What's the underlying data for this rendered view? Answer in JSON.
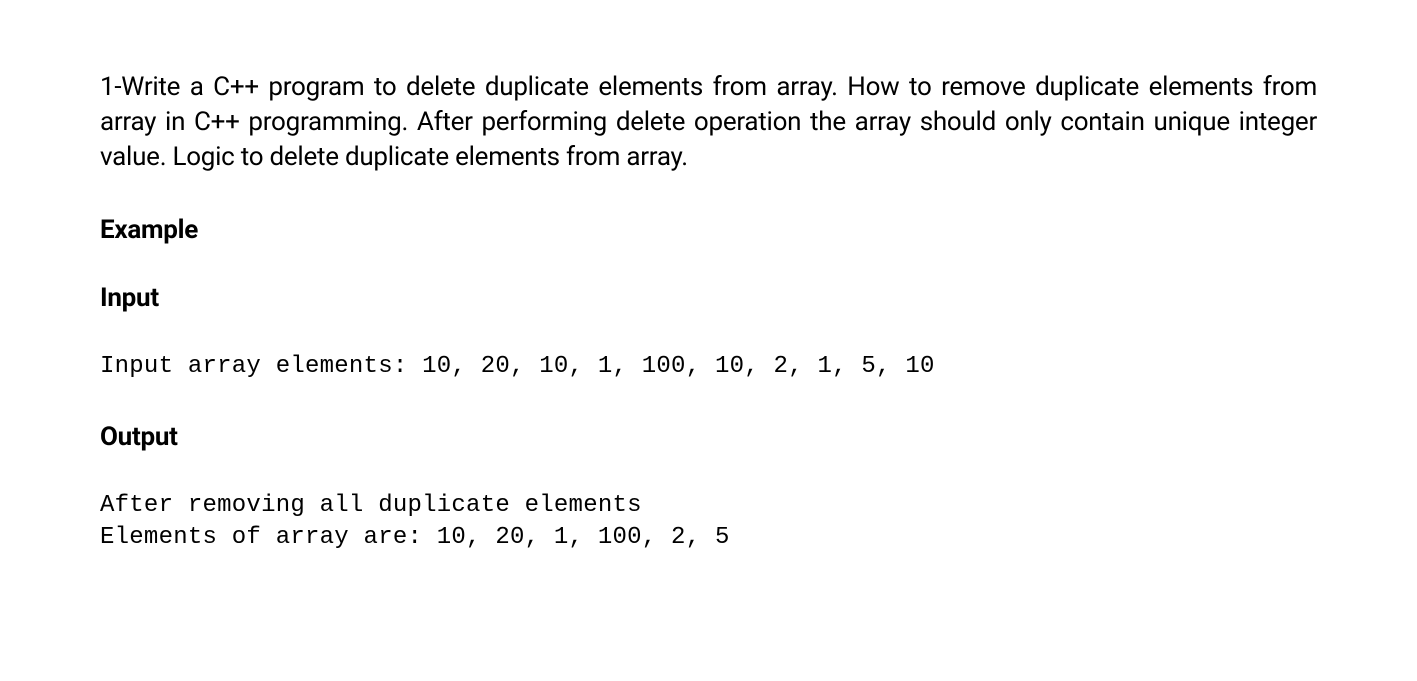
{
  "problem": {
    "statement": "1-Write a C++ program to delete duplicate elements from array. How to remove duplicate elements from array in C++ programming. After performing delete operation the array should only contain unique integer value. Logic to delete duplicate elements from array."
  },
  "example": {
    "heading": "Example",
    "input": {
      "heading": "Input",
      "text": "Input array elements: 10, 20, 10, 1, 100, 10, 2, 1, 5, 10"
    },
    "output": {
      "heading": "Output",
      "text": "After removing all duplicate elements\nElements of array are: 10, 20, 1, 100, 2, 5"
    }
  }
}
